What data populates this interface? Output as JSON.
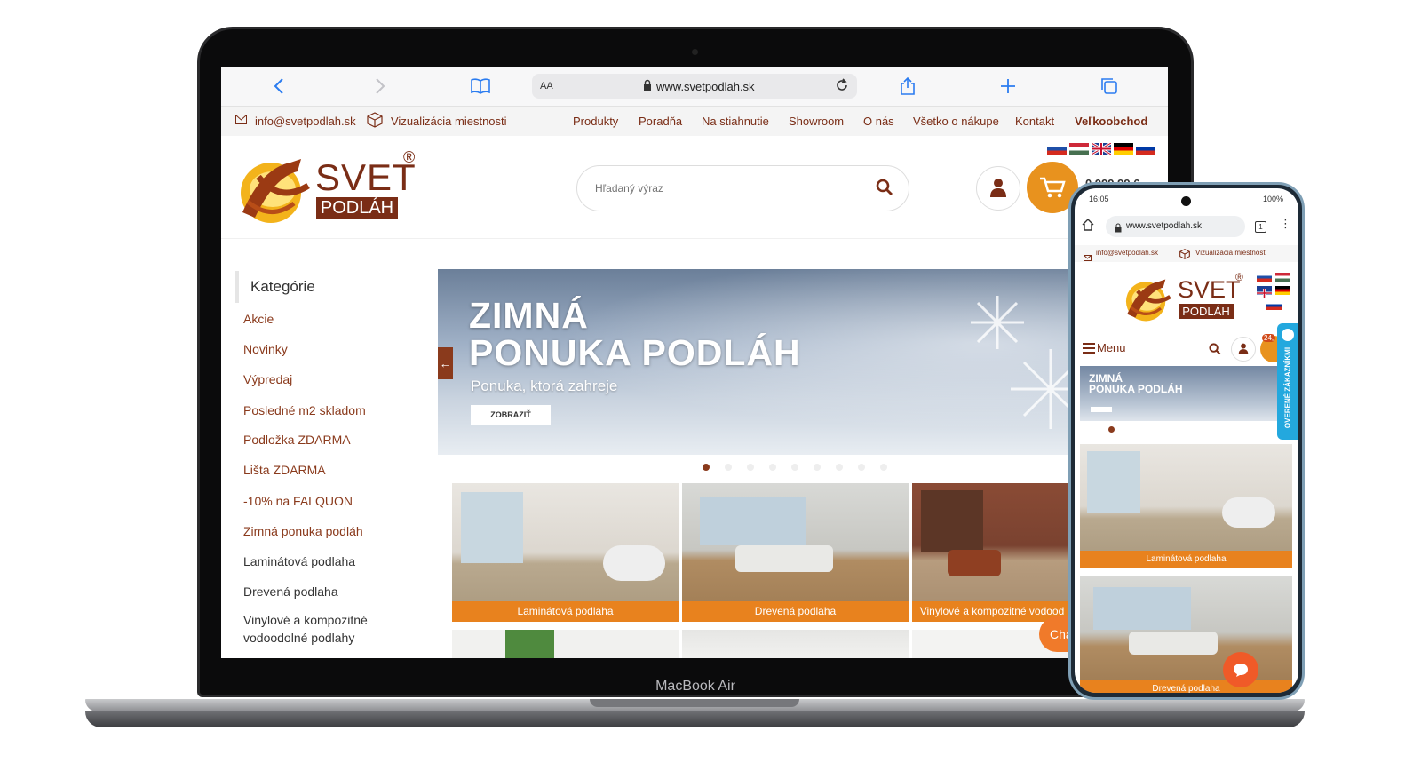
{
  "browser": {
    "url": "www.svetpodlah.sk",
    "text_size_label": "AA"
  },
  "topbar": {
    "email": "info@svetpodlah.sk",
    "visualization": "Vizualizácia miestnosti",
    "nav": [
      "Produkty",
      "Poradňa",
      "Na stiahnutie",
      "Showroom",
      "O nás",
      "Všetko o nákupe",
      "Kontakt",
      "Veľkoobchod"
    ]
  },
  "logo": {
    "line1": "SVET",
    "line2": "PODLÁH",
    "mark": "®"
  },
  "search": {
    "placeholder": "Hľadaný výraz"
  },
  "header": {
    "phone_partial": "0 999 99 6"
  },
  "sidebar": {
    "title": "Kategórie",
    "items": [
      "Akcie",
      "Novinky",
      "Výpredaj",
      "Posledné m2 skladom",
      "Podložka ZDARMA",
      "Lišta ZDARMA",
      "-10% na FALQUON",
      "Zimná ponuka podláh",
      "Laminátová podlaha",
      "Drevená podlaha",
      "Vinylové a kompozitné",
      "vodoodolné podlahy"
    ]
  },
  "banner": {
    "line1": "ZIMNÁ",
    "line2": "PONUKA PODLÁH",
    "subtitle": "Ponuka, ktorá zahreje",
    "button": "ZOBRAZIŤ",
    "prev_arrow": "←"
  },
  "tiles": [
    "Laminátová podlaha",
    "Drevená podlaha",
    "Vinylové a kompozitné vodood"
  ],
  "chat": {
    "label": "Cha"
  },
  "laptop": {
    "brand": "MacBook Air"
  },
  "phone": {
    "time": "16:05",
    "battery": "100%",
    "url": "www.svetpodlah.sk",
    "tab_count": "1",
    "email": "info@svetpodlah.sk",
    "visualization": "Vizualizácia miestnosti",
    "menu_label": "Menu",
    "cart_badge": "24,",
    "verified_tab": "OVERENÉ ZÁKAZNÍKMI",
    "banner_line1": "ZIMNÁ",
    "banner_line2": "PONUKA PODLÁH",
    "tiles": [
      "Laminátová podlaha",
      "Drevená podlaha"
    ]
  },
  "colors": {
    "brand_brown": "#7a2d16",
    "accent_orange": "#e8821e",
    "link_blue": "#2b7cf0"
  }
}
